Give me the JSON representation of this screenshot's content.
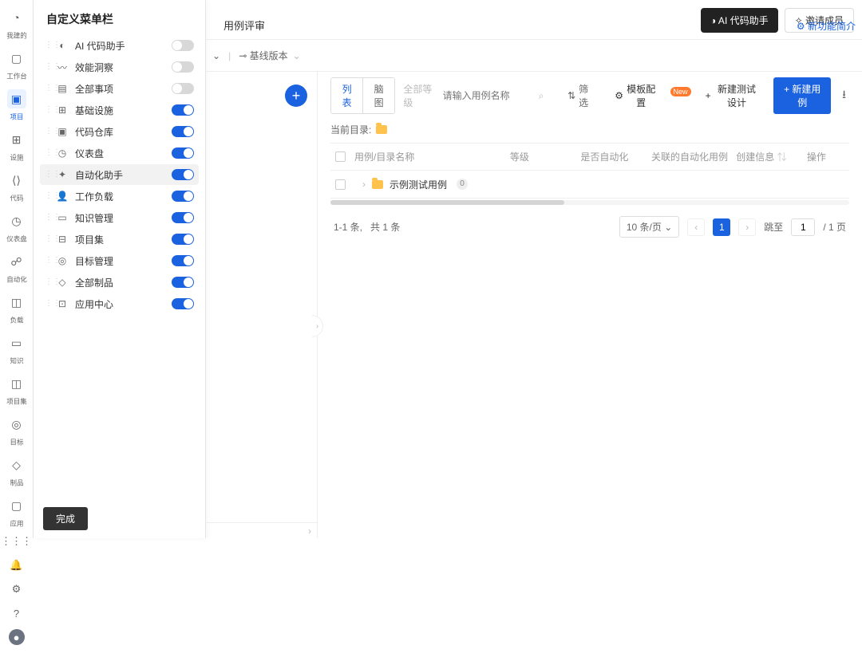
{
  "top_buttons": {
    "ai": "◑ AI 代码助手",
    "invite": "✧ 邀请成员"
  },
  "rail": [
    {
      "label": "我建的",
      "icon": "◔"
    },
    {
      "label": "工作台",
      "icon": "▢"
    },
    {
      "label": "项目",
      "icon": "▣",
      "active": true
    },
    {
      "label": "设施",
      "icon": "⊞"
    },
    {
      "label": "代码",
      "icon": "⟨⟩"
    },
    {
      "label": "仪表盘",
      "icon": "◷"
    },
    {
      "label": "自动化",
      "icon": "☍"
    },
    {
      "label": "负载",
      "icon": "◫"
    },
    {
      "label": "知识",
      "icon": "▭"
    },
    {
      "label": "项目集",
      "icon": "◫"
    },
    {
      "label": "目标",
      "icon": "◎"
    },
    {
      "label": "制品",
      "icon": "◇"
    },
    {
      "label": "应用",
      "icon": "▢"
    }
  ],
  "menu": {
    "title": "自定义菜单栏",
    "items": [
      {
        "icon": "◐",
        "label": "AI 代码助手",
        "on": false
      },
      {
        "icon": "〰",
        "label": "效能洞察",
        "on": false
      },
      {
        "icon": "▤",
        "label": "全部事项",
        "on": false
      },
      {
        "icon": "⊞",
        "label": "基础设施",
        "on": true
      },
      {
        "icon": "▣",
        "label": "代码仓库",
        "on": true
      },
      {
        "icon": "◷",
        "label": "仪表盘",
        "on": true
      },
      {
        "icon": "✦",
        "label": "自动化助手",
        "on": true,
        "selected": true
      },
      {
        "icon": "👤",
        "label": "工作负载",
        "on": true
      },
      {
        "icon": "▭",
        "label": "知识管理",
        "on": true
      },
      {
        "icon": "⊟",
        "label": "项目集",
        "on": true
      },
      {
        "icon": "◎",
        "label": "目标管理",
        "on": true
      },
      {
        "icon": "◇",
        "label": "全部制品",
        "on": true
      },
      {
        "icon": "⊡",
        "label": "应用中心",
        "on": true
      }
    ],
    "done": "完成"
  },
  "page": {
    "tab": "用例评审",
    "new_features": "⚙ 新功能简介",
    "branch": "⊸ 基线版本",
    "chev": "⌄",
    "leftcol_hint": ""
  },
  "toolbar": {
    "view_list": "列表",
    "view_map": "脑图",
    "search_label": "全部等级",
    "search_placeholder": "请输入用例名称",
    "filter": "筛选",
    "template": "模板配置",
    "new_badge": "New",
    "new_design": "新建测试设计",
    "new_case": "+ 新建用例"
  },
  "current_dir": {
    "label": "当前目录:"
  },
  "table": {
    "headers": [
      "用例/目录名称",
      "等级",
      "是否自动化",
      "关联的自动化用例",
      "创建信息",
      "操作"
    ],
    "rows": [
      {
        "name": "示例测试用例",
        "count": "0"
      }
    ]
  },
  "pagination": {
    "summary_prefix": "1-1 条,",
    "summary_total": "共 1 条",
    "page_size": "10 条/页",
    "current": "1",
    "jump_label": "跳至",
    "jump_value": "1",
    "total_pages": "/ 1 页"
  }
}
